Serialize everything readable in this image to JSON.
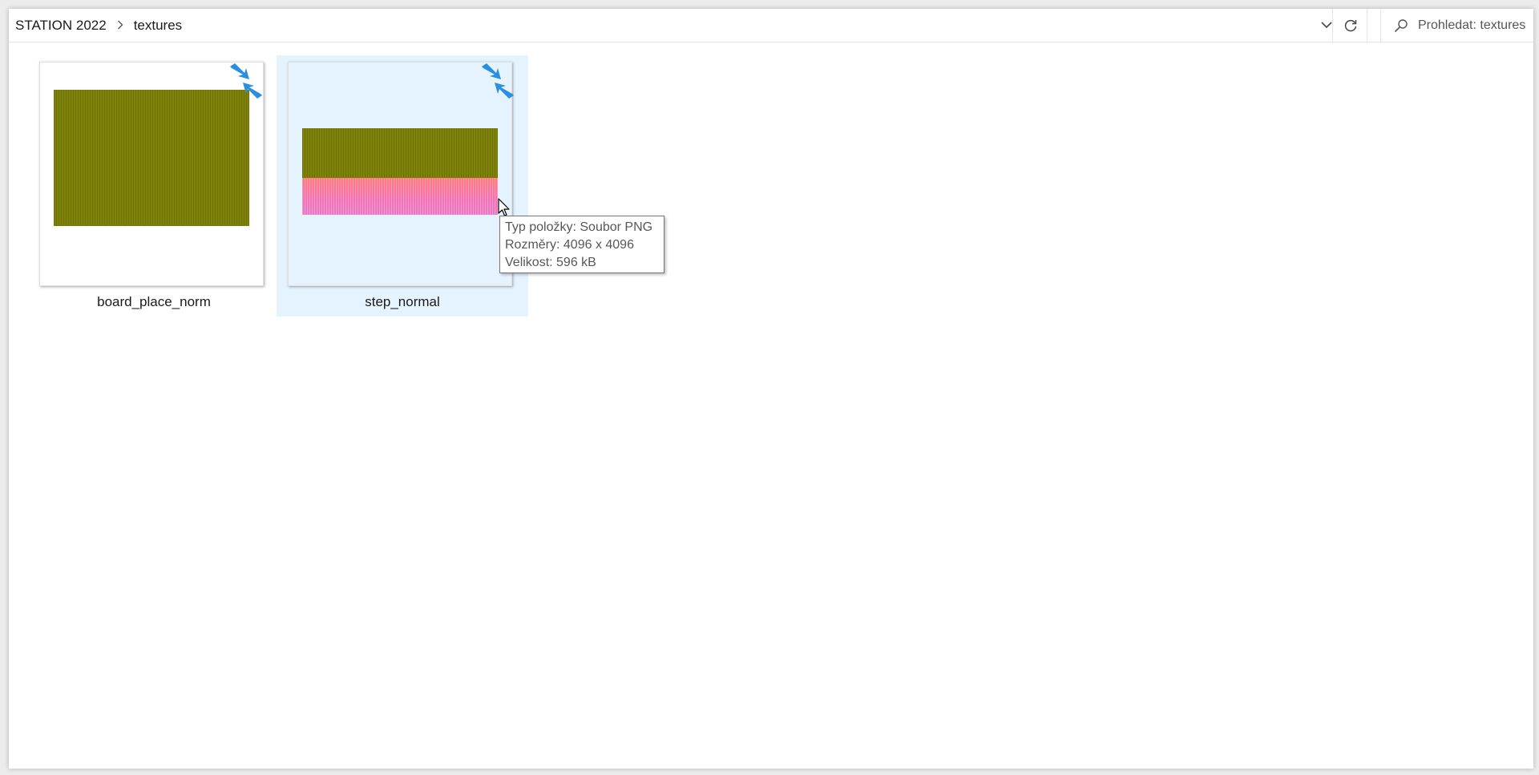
{
  "address_bar": {
    "breadcrumb": [
      "STATION 2022",
      "textures"
    ],
    "search_placeholder": "Prohledat: textures"
  },
  "icons": {
    "breadcrumb_separator": "chevron-right-icon",
    "dropdown": "chevron-down-icon",
    "refresh": "refresh-icon",
    "search": "search-icon",
    "shortcut_overlay": "compress-arrows-icon",
    "cursor": "mouse-pointer-icon"
  },
  "files": [
    {
      "name": "board_place_norm",
      "selected": false
    },
    {
      "name": "step_normal",
      "selected": true
    }
  ],
  "tooltip": {
    "type_line": "Typ položky: Soubor PNG",
    "dimensions_line": "Rozměry: 4096 x 4096",
    "size_line": "Velikost: 596 kB"
  },
  "colors": {
    "selection_bg": "#e5f3ff",
    "texture_olive": "#7e8208",
    "texture_pink": "#f472b6",
    "overlay_blue": "#2b8fe0"
  }
}
